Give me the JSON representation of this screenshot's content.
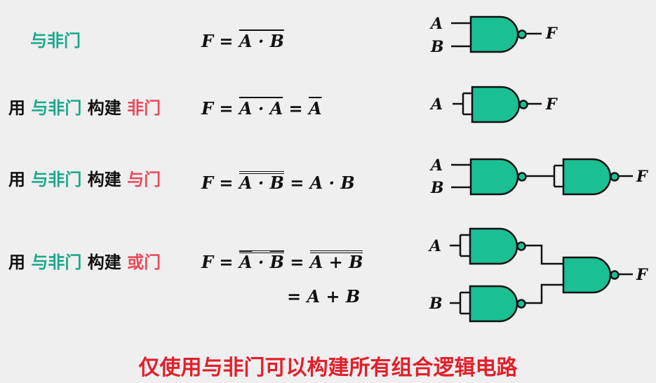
{
  "rows": [
    {
      "prefix": "",
      "gate1": "与非门",
      "verb": "",
      "target": "",
      "formula": {
        "lhs": "F =",
        "expr": "A · B"
      }
    },
    {
      "prefix": "用",
      "gate1": "与非门",
      "verb": "构建",
      "target": "非门",
      "formula": {
        "lhs": "F =",
        "expr1": "A · A",
        "eq2": "=",
        "expr2": "A"
      }
    },
    {
      "prefix": "用",
      "gate1": "与非门",
      "verb": "构建",
      "target": "与门",
      "formula": {
        "lhs": "F =",
        "expr1": "A · B",
        "eq2": "= A · B"
      }
    },
    {
      "prefix": "用",
      "gate1": "与非门",
      "verb": "构建",
      "target": "或门",
      "formula": {
        "lhs": "F =",
        "a": "A",
        "dot": "·",
        "b": "B",
        "eq2": "=",
        "sum": "A + B",
        "line2": "= A + B"
      }
    }
  ],
  "pins": {
    "a": "A",
    "b": "B",
    "f": "F"
  },
  "footer": "仅使用与非门可以构建所有组合逻辑电路",
  "colors": {
    "background": "#efefef",
    "gate_fill": "#1bbf94",
    "gate_stroke": "#111111",
    "green_text": "#1aa88a",
    "red_text": "#e84a5a",
    "footer_text": "#e0202c"
  }
}
